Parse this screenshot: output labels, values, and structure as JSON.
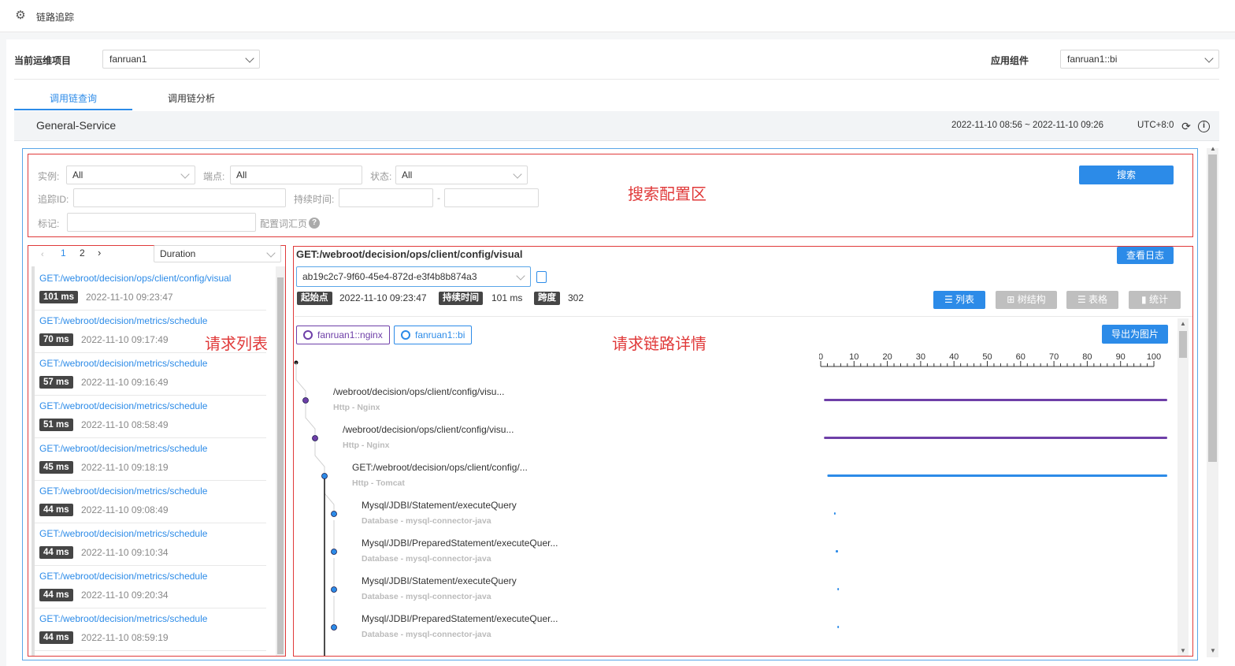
{
  "app": {
    "title": "链路追踪",
    "icon": "gear-icon"
  },
  "filters": {
    "project_label": "当前运维项目",
    "project_value": "fanruan1",
    "component_label": "应用组件",
    "component_value": "fanruan1::bi"
  },
  "tabs": [
    {
      "label": "调用链查询",
      "active": true
    },
    {
      "label": "调用链分析",
      "active": false
    }
  ],
  "service": {
    "name": "General-Service",
    "time_range": "2022-11-10 08:56 ~ 2022-11-10 09:26",
    "timezone": "UTC+8:0"
  },
  "search": {
    "instance_label": "实例:",
    "instance_value": "All",
    "endpoint_label": "端点:",
    "endpoint_value": "All",
    "status_label": "状态:",
    "status_value": "All",
    "trace_id_label": "追踪ID:",
    "duration_label": "持续时间:",
    "duration_sep": "-",
    "tag_label": "标记:",
    "vocab_label": "配置词汇页",
    "search_button": "搜索"
  },
  "annotations": {
    "search_area": "搜索配置区",
    "request_list": "请求列表",
    "request_detail": "请求链路详情"
  },
  "list": {
    "pages": [
      "1",
      "2"
    ],
    "sort_value": "Duration",
    "items": [
      {
        "url": "GET:/webroot/decision/ops/client/config/visual",
        "duration": "101 ms",
        "time": "2022-11-10 09:23:47"
      },
      {
        "url": "GET:/webroot/decision/metrics/schedule",
        "duration": "70 ms",
        "time": "2022-11-10 09:17:49"
      },
      {
        "url": "GET:/webroot/decision/metrics/schedule",
        "duration": "57 ms",
        "time": "2022-11-10 09:16:49"
      },
      {
        "url": "GET:/webroot/decision/metrics/schedule",
        "duration": "51 ms",
        "time": "2022-11-10 08:58:49"
      },
      {
        "url": "GET:/webroot/decision/metrics/schedule",
        "duration": "45 ms",
        "time": "2022-11-10 09:18:19"
      },
      {
        "url": "GET:/webroot/decision/metrics/schedule",
        "duration": "44 ms",
        "time": "2022-11-10 09:08:49"
      },
      {
        "url": "GET:/webroot/decision/metrics/schedule",
        "duration": "44 ms",
        "time": "2022-11-10 09:10:34"
      },
      {
        "url": "GET:/webroot/decision/metrics/schedule",
        "duration": "44 ms",
        "time": "2022-11-10 09:20:34"
      },
      {
        "url": "GET:/webroot/decision/metrics/schedule",
        "duration": "44 ms",
        "time": "2022-11-10 08:59:19"
      }
    ]
  },
  "detail": {
    "title": "GET:/webroot/decision/ops/client/config/visual",
    "view_log_button": "查看日志",
    "trace_id": "ab19c2c7-9f60-45e4-872d-e3f4b8b874a3",
    "start_label": "起始点",
    "start_value": "2022-11-10 09:23:47",
    "duration_label": "持续时间",
    "duration_value": "101 ms",
    "span_label": "跨度",
    "span_value": "302",
    "views": [
      "列表",
      "树结构",
      "表格",
      "统计"
    ],
    "export_button": "导出为图片",
    "legend": [
      {
        "name": "fanruan1::nginx",
        "color": "#6e3fa8"
      },
      {
        "name": "fanruan1::bi",
        "color": "#2c8be8"
      }
    ],
    "axis_ticks": [
      "0",
      "10",
      "20",
      "30",
      "40",
      "50",
      "60",
      "70",
      "80",
      "90",
      "100"
    ],
    "spans": [
      {
        "name": "/webroot/decision/ops/client/config/visu...",
        "sub": "Http - Nginx",
        "color": "#6e3fa8",
        "start": 1,
        "end": 104
      },
      {
        "name": "/webroot/decision/ops/client/config/visu...",
        "sub": "Http - Nginx",
        "color": "#6e3fa8",
        "start": 1,
        "end": 104
      },
      {
        "name": "GET:/webroot/decision/ops/client/config/...",
        "sub": "Http - Tomcat",
        "color": "#2c8be8",
        "start": 2,
        "end": 104
      },
      {
        "name": "Mysql/JDBI/Statement/executeQuery",
        "sub": "Database - mysql-connector-java",
        "color": "#2c8be8",
        "start": 4,
        "end": 4.3
      },
      {
        "name": "Mysql/JDBI/PreparedStatement/executeQuer...",
        "sub": "Database - mysql-connector-java",
        "color": "#2c8be8",
        "start": 4.5,
        "end": 5.2
      },
      {
        "name": "Mysql/JDBI/Statement/executeQuery",
        "sub": "Database - mysql-connector-java",
        "color": "#2c8be8",
        "start": 5,
        "end": 5.3
      },
      {
        "name": "Mysql/JDBI/PreparedStatement/executeQuer...",
        "sub": "Database - mysql-connector-java",
        "color": "#2c8be8",
        "start": 5,
        "end": 5.3
      }
    ]
  }
}
